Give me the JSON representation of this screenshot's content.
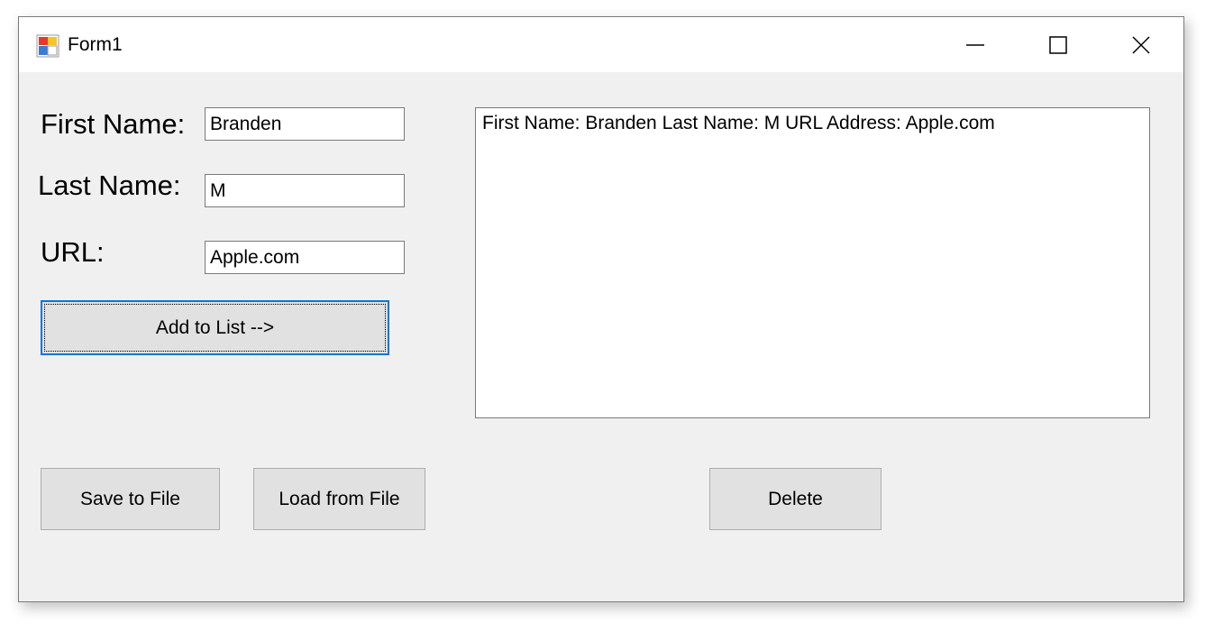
{
  "window": {
    "title": "Form1",
    "icon": "winforms-app-icon",
    "controls": {
      "minimize_icon": "minimize-icon",
      "maximize_icon": "maximize-icon",
      "close_icon": "close-icon"
    }
  },
  "form": {
    "first_name": {
      "label": "First Name:",
      "value": "Branden"
    },
    "last_name": {
      "label": "Last Name:",
      "value": "M"
    },
    "url": {
      "label": "URL:",
      "value": "Apple.com"
    },
    "add_button": "Add to List -->"
  },
  "list": {
    "items": [
      "First Name: Branden Last Name: M URL Address: Apple.com"
    ]
  },
  "actions": {
    "save_button": "Save to File",
    "load_button": "Load from File",
    "delete_button": "Delete"
  },
  "colors": {
    "focus_border": "#0078d7",
    "window_background": "#f0f0f0",
    "button_face": "#e1e1e1"
  }
}
